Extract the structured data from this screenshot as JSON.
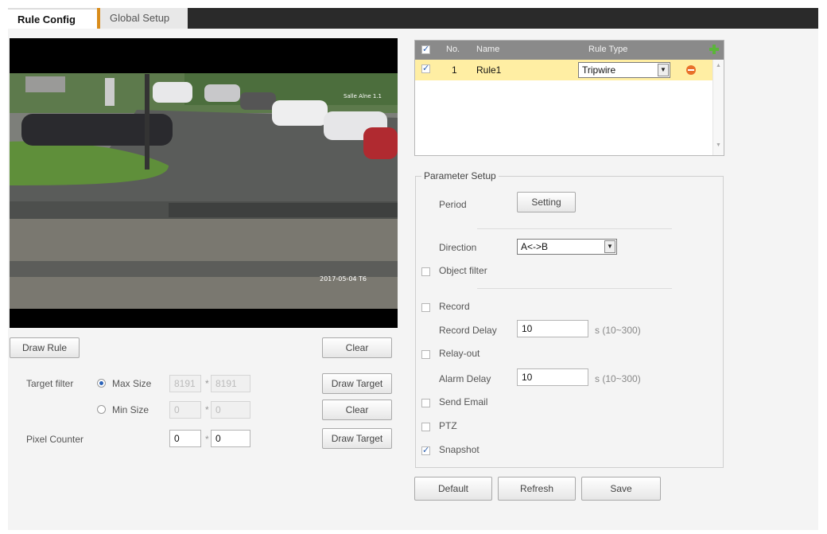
{
  "tabs": {
    "rule_config": "Rule Config",
    "global_setup": "Global Setup"
  },
  "video": {
    "osd_top": "Salle Alne 1.1",
    "osd_bottom": "2017-05-04 T6"
  },
  "left": {
    "draw_rule": "Draw Rule",
    "clear_top": "Clear",
    "target_filter": "Target filter",
    "max_size": "Max Size",
    "min_size": "Min Size",
    "max_w": "8191",
    "max_h": "8191",
    "min_w": "0",
    "min_h": "0",
    "draw_target_1": "Draw Target",
    "clear_mid": "Clear",
    "pixel_counter": "Pixel Counter",
    "px_w": "0",
    "px_h": "0",
    "draw_target_2": "Draw Target"
  },
  "rule_table": {
    "col_no": "No.",
    "col_name": "Name",
    "col_type": "Rule Type",
    "rows": [
      {
        "no": "1",
        "name": "Rule1",
        "type": "Tripwire"
      }
    ]
  },
  "params": {
    "legend": "Parameter Setup",
    "period": "Period",
    "setting": "Setting",
    "direction": "Direction",
    "direction_value": "A<->B",
    "object_filter": "Object filter",
    "record": "Record",
    "record_delay": "Record Delay",
    "record_delay_value": "10",
    "record_range": "s (10~300)",
    "relay_out": "Relay-out",
    "alarm_delay": "Alarm Delay",
    "alarm_delay_value": "10",
    "alarm_range": "s (10~300)",
    "send_email": "Send Email",
    "ptz": "PTZ",
    "snapshot": "Snapshot"
  },
  "footer": {
    "default": "Default",
    "refresh": "Refresh",
    "save": "Save"
  },
  "colors": {
    "tab_accent": "#d98c1a",
    "row_selected": "#ffeea3",
    "add_icon": "#5bb53a",
    "delete_icon": "#e8702a"
  }
}
